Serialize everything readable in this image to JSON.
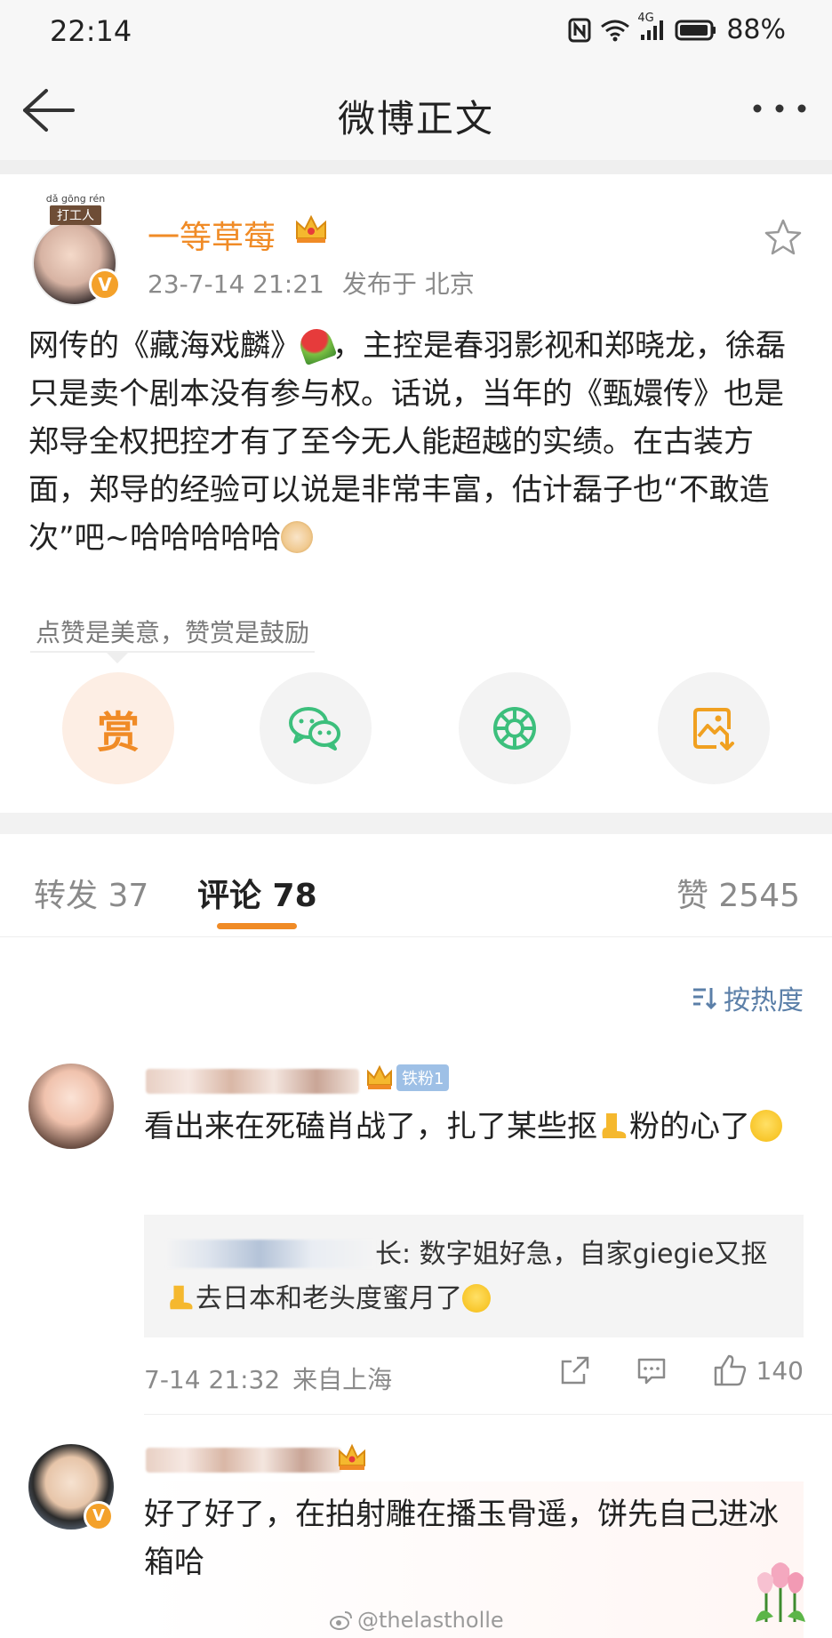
{
  "status_bar": {
    "time": "22:14",
    "network": "4G",
    "battery": "88%"
  },
  "nav": {
    "title": "微博正文"
  },
  "post": {
    "author": "一等草莓",
    "avatar_tag_pinyin": "dǎ gōng rén",
    "avatar_tag_text": "打工人",
    "verify_mark": "V",
    "date": "23-7-14 21:21",
    "location": "发布于 北京",
    "text_1": "网传的《藏海戏麟》",
    "text_2": "，主控是春羽影视和郑晓龙，徐磊只是卖个剧本没有参与权。话说，当年的《甄嬛传》也是郑导全权把控才有了至今无人能超越的实绩。在古装方面，郑导的经验可以说是非常丰富，估计磊子也“不敢造次”吧~哈哈哈哈哈",
    "reward_hint": "点赞是美意，赞赏是鼓励",
    "reward_label": "赏"
  },
  "tabs": {
    "repost": "转发 37",
    "comments": "评论 78",
    "likes": "赞 2545"
  },
  "sort_label": "按热度",
  "comments": [
    {
      "badge": "铁粉1",
      "text": "看出来在死磕肖战了，扎了某些抠",
      "text_tail": "粉的心了",
      "reply_prefix": "长: 数字姐好急，自家giegie又抠",
      "reply_tail": "去日本和老头度蜜月了",
      "date": "7-14 21:32",
      "source": "来自上海",
      "likes": "140"
    },
    {
      "verify_mark": "V",
      "text": "好了好了，在拍射雕在播玉骨遥，饼先自己进冰箱哈"
    }
  ],
  "watermark": "@thelastholle",
  "colors": {
    "accent": "#f08b26",
    "link": "#5b7fa8",
    "wechat": "#3cbf7c",
    "moments": "#3cbf7c",
    "save": "#f0a020"
  }
}
